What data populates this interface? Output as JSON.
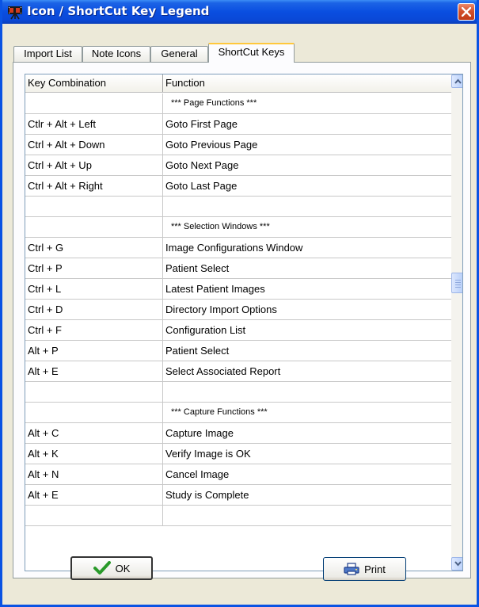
{
  "window": {
    "title": "Icon / ShortCut Key Legend"
  },
  "tabs": [
    {
      "label": "Import List",
      "active": false
    },
    {
      "label": "Note Icons",
      "active": false
    },
    {
      "label": "General",
      "active": false
    },
    {
      "label": "ShortCut Keys",
      "active": true
    }
  ],
  "grid": {
    "columns": [
      "Key Combination",
      "Function"
    ],
    "rows": [
      {
        "key": "",
        "fn": "*** Page Functions ***"
      },
      {
        "key": "Ctlr + Alt + Left",
        "fn": "Goto First Page"
      },
      {
        "key": "Ctrl + Alt + Down",
        "fn": "Goto Previous Page"
      },
      {
        "key": "Ctrl + Alt + Up",
        "fn": "Goto Next Page"
      },
      {
        "key": "Ctrl + Alt + Right",
        "fn": "Goto Last Page"
      },
      {
        "key": "",
        "fn": ""
      },
      {
        "key": "",
        "fn": "*** Selection Windows ***"
      },
      {
        "key": "Ctrl + G",
        "fn": "Image Configurations Window"
      },
      {
        "key": "Ctrl + P",
        "fn": "Patient Select"
      },
      {
        "key": "Ctrl + L",
        "fn": "Latest Patient Images"
      },
      {
        "key": "Ctrl + D",
        "fn": "Directory Import Options"
      },
      {
        "key": "Ctrl + F",
        "fn": "Configuration List"
      },
      {
        "key": "Alt + P",
        "fn": "Patient Select"
      },
      {
        "key": "Alt + E",
        "fn": "Select Associated Report"
      },
      {
        "key": "",
        "fn": ""
      },
      {
        "key": "",
        "fn": "*** Capture Functions ***"
      },
      {
        "key": "Alt + C",
        "fn": "Capture Image"
      },
      {
        "key": "Alt + K",
        "fn": "Verify Image is OK"
      },
      {
        "key": "Alt + N",
        "fn": "Cancel Image"
      },
      {
        "key": "Alt + E",
        "fn": "Study is Complete"
      },
      {
        "key": "",
        "fn": ""
      }
    ]
  },
  "buttons": {
    "ok_label": "OK",
    "print_label": "Print"
  },
  "colors": {
    "titlebar": "#0a4ee0",
    "ok_check": "#2a9a2a",
    "dialog_bg": "#ece9d8"
  }
}
